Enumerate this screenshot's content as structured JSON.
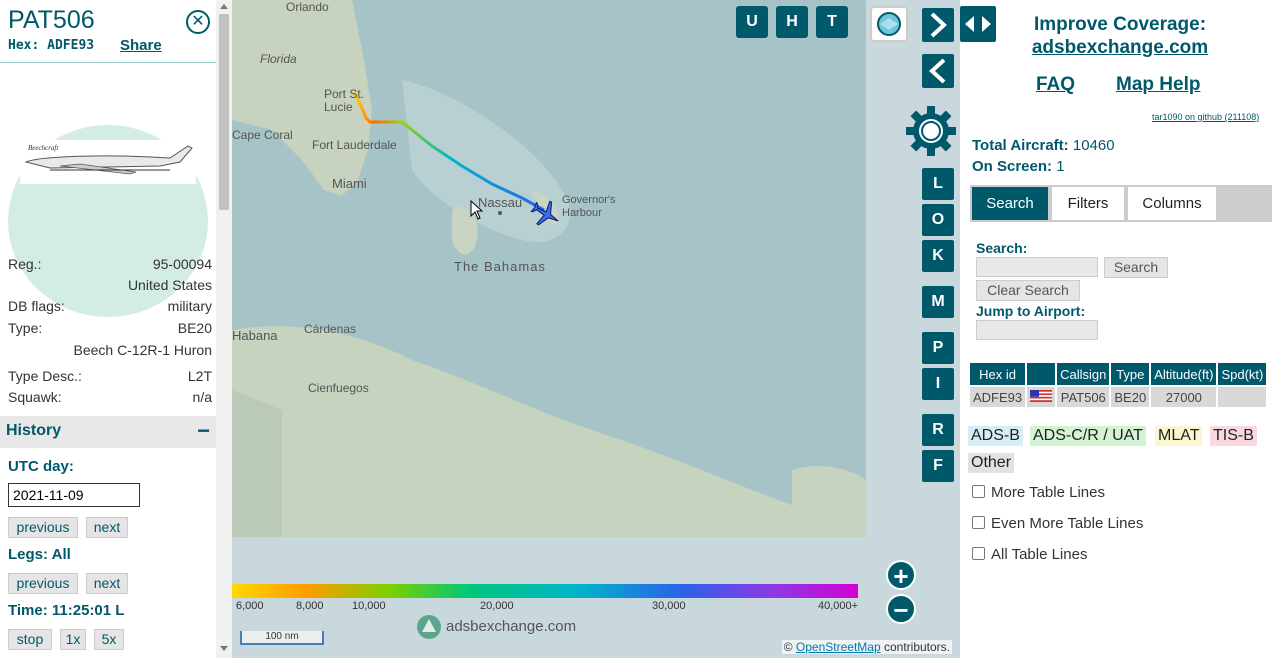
{
  "aircraft": {
    "callsign": "PAT506",
    "hex_label": "Hex:",
    "hex": "ADFE93",
    "share_label": "Share",
    "info": [
      {
        "key": "Reg.:",
        "value": "95-00094"
      },
      {
        "key": "",
        "value": "United States"
      },
      {
        "key": "DB flags:",
        "value": "military"
      },
      {
        "key": "Type:",
        "value": "BE20"
      },
      {
        "key": "",
        "value": "Beech C-12R-1 Huron"
      },
      {
        "key": "Type Desc.:",
        "value": "L2T"
      },
      {
        "key": "Squawk:",
        "value": "n/a"
      }
    ]
  },
  "history": {
    "title": "History",
    "collapse_icon": "minus-icon",
    "utc_day_label": "UTC day:",
    "utc_day_value": "2021-11-09",
    "previous_label": "previous",
    "next_label": "next",
    "legs_label": "Legs: All",
    "time_label": "Time: 11:25:01 L",
    "stop_label": "stop",
    "speed1_label": "1x",
    "speed5_label": "5x"
  },
  "map": {
    "top_buttons": [
      "U",
      "H",
      "T"
    ],
    "side_buttons": [
      "L",
      "O",
      "K",
      "M",
      "P",
      "I",
      "R",
      "F"
    ],
    "labels": {
      "florida": "Florida",
      "port_st_lucie": "Port St. Lucie",
      "cape_coral": "Cape Coral",
      "fort_lauderdale": "Fort Lauderdale",
      "miami": "Miami",
      "nassau": "Nassau",
      "governors_harbour": "Governor's Harbour",
      "bahamas": "The Bahamas",
      "cardenas": "Cárdenas",
      "cienfuegos": "Cienfuegos",
      "habana": "Habana",
      "orlando": "Orlando"
    },
    "altitude_scale": [
      "6,000",
      "8,000",
      "10,000",
      "20,000",
      "30,000",
      "40,000+"
    ],
    "scale_label": "100 nm",
    "brand": "adsbexchange.com",
    "attribution_prefix": "©",
    "attribution_link": "OpenStreetMap",
    "attribution_suffix": "contributors.",
    "zoom_in": "+",
    "zoom_out": "−"
  },
  "right": {
    "improve_line1": "Improve Coverage:",
    "improve_link": "adsbexchange.com",
    "faq": "FAQ",
    "map_help": "Map Help",
    "github": "tar1090 on github (211108)",
    "total_label": "Total Aircraft:",
    "total_value": "10460",
    "onscreen_label": "On Screen:",
    "onscreen_value": "1",
    "tabs": [
      "Search",
      "Filters",
      "Columns"
    ],
    "search_label": "Search:",
    "search_button": "Search",
    "clear_search": "Clear Search",
    "jump_label": "Jump to Airport:",
    "table": {
      "headers": [
        "Hex id",
        "",
        "Callsign",
        "Type",
        "Altitude(ft)",
        "Spd(kt)"
      ],
      "rows": [
        [
          "ADFE93",
          "",
          "PAT506",
          "BE20",
          "27000",
          ""
        ]
      ]
    },
    "legend": [
      {
        "label": "ADS-B",
        "color": "#d6ecf7"
      },
      {
        "label": "ADS-C/R / UAT",
        "color": "#d3f3d3"
      },
      {
        "label": "MLAT",
        "color": "#fcf6d0"
      },
      {
        "label": "TIS-B",
        "color": "#fbd8e0"
      },
      {
        "label": "Other",
        "color": "#e2e2e2"
      }
    ],
    "checkboxes": [
      "More Table Lines",
      "Even More Table Lines",
      "All Table Lines"
    ]
  }
}
